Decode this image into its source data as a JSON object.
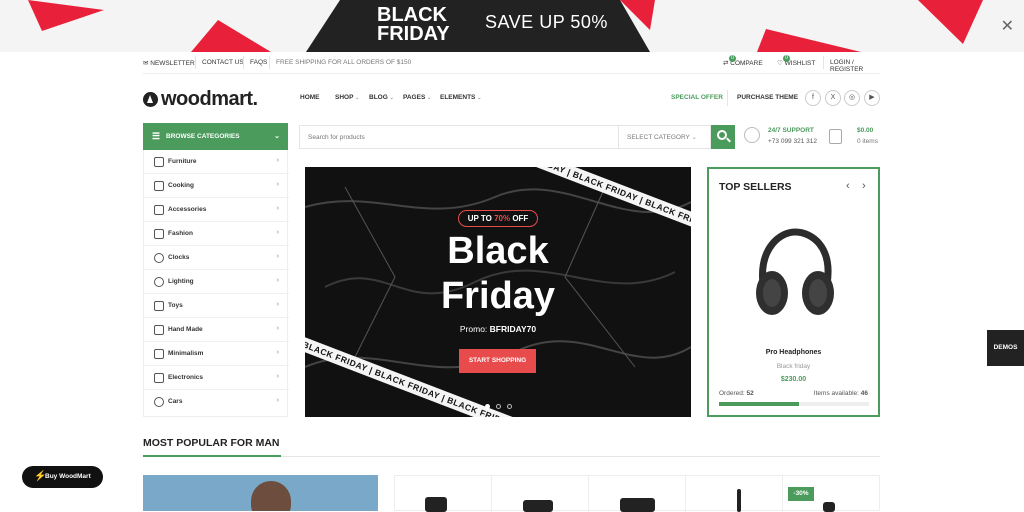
{
  "promo": {
    "title": "BLACK FRIDAY",
    "save": "SAVE UP 50%",
    "close_icon": "close-icon"
  },
  "topbar": {
    "newsletter": "NEWSLETTER",
    "contact": "CONTACT US",
    "faqs": "FAQS",
    "shipping": "FREE SHIPPING FOR ALL ORDERS OF $150",
    "compare": "COMPARE",
    "wishlist": "WISHLIST",
    "account": "LOGIN / REGISTER",
    "compare_count": "0",
    "wishlist_count": "0"
  },
  "header": {
    "logo": "woodmart.",
    "nav": [
      "HOME",
      "SHOP",
      "BLOG",
      "PAGES",
      "ELEMENTS"
    ],
    "special_offer": "SPECIAL OFFER",
    "purchase_theme": "PURCHASE THEME",
    "social": [
      "f",
      "X",
      "◎",
      "▶"
    ]
  },
  "categories": {
    "heading": "BROWSE CATEGORIES",
    "items": [
      "Furniture",
      "Cooking",
      "Accessories",
      "Fashion",
      "Clocks",
      "Lighting",
      "Toys",
      "Hand Made",
      "Minimalism",
      "Electronics",
      "Cars"
    ]
  },
  "search": {
    "placeholder": "Search for products",
    "category": "SELECT CATEGORY"
  },
  "support": {
    "label": "24/7 SUPPORT",
    "phone": "+73 099 321 312"
  },
  "cart": {
    "total": "$0.00",
    "items": "0 items"
  },
  "hero": {
    "tape_text": "BLACK FRIDAY | BLACK FRIDAY | BLACK FRIDAY | BLACK FRIDAY",
    "off_prefix": "UP TO ",
    "off_value": "70%",
    "off_suffix": " OFF",
    "title": "Black Friday",
    "promo_label": "Promo: ",
    "promo_code": "BFRIDAY70",
    "cta": "START SHOPPING",
    "slides": 3,
    "active_slide": 1
  },
  "top_sellers": {
    "title": "TOP SELLERS",
    "product_name": "Pro Headphones",
    "category": "Black friday",
    "price": "$230.00",
    "ordered_label": "Ordered: ",
    "ordered": "52",
    "available_label": "Items available: ",
    "available": "46",
    "progress_fraction": 0.53
  },
  "demos": "DEMOS",
  "section": {
    "title": "MOST POPULAR FOR MAN"
  },
  "sale_badge": "-30%",
  "buy_button": "Buy WoodMart",
  "colors": {
    "brand": "#4a9b5c",
    "accent": "#e84b4b",
    "dark": "#111111"
  }
}
